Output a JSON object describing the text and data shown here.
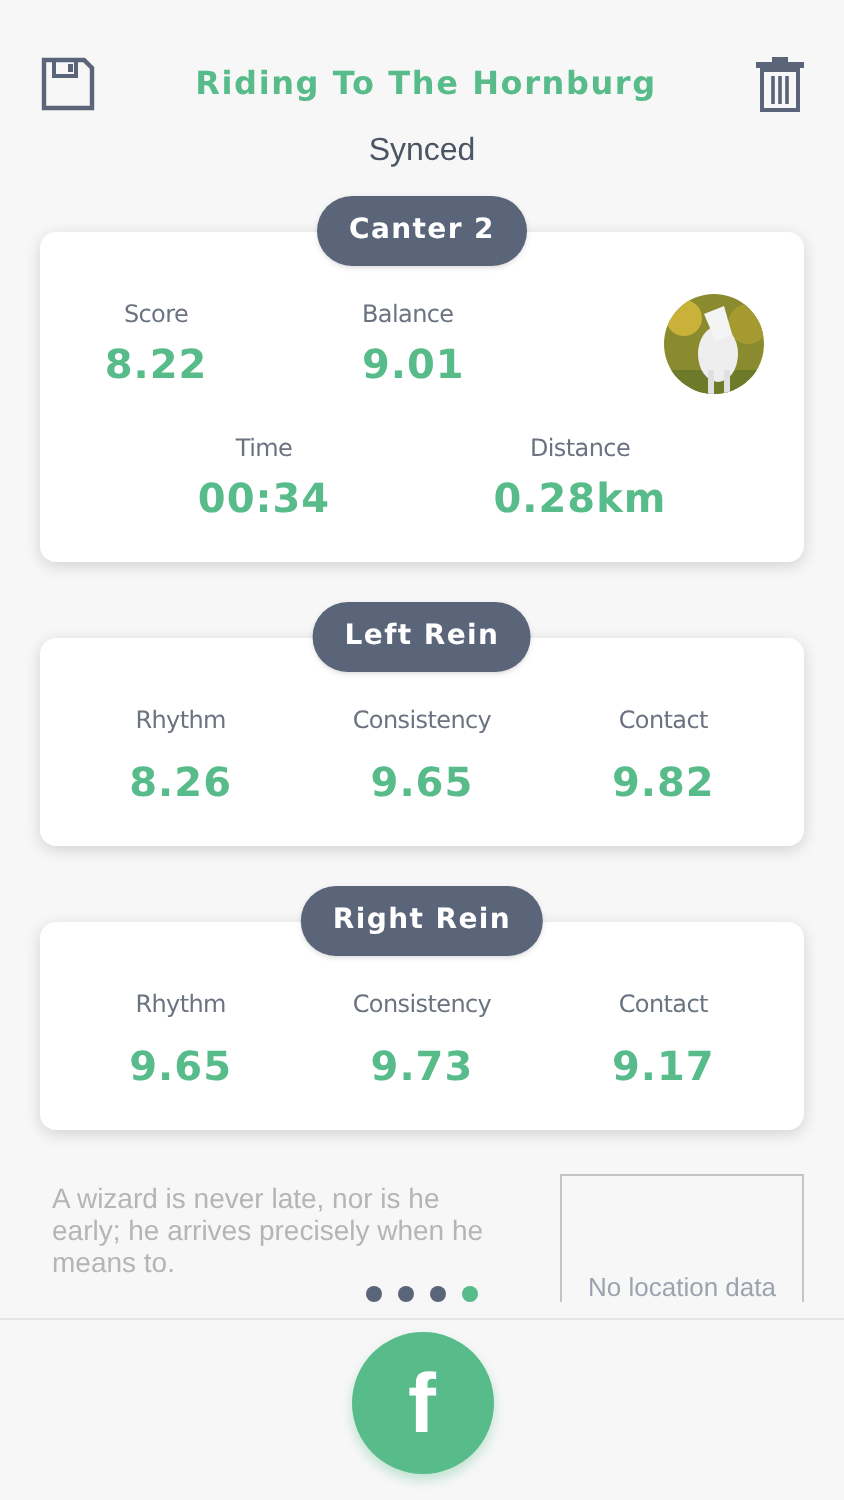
{
  "header": {
    "title": "Riding To The Hornburg",
    "status": "Synced"
  },
  "sections": [
    {
      "title": "Canter 2",
      "kind": "summary",
      "stats": [
        {
          "label": "Score",
          "value": "8.22"
        },
        {
          "label": "Balance",
          "value": "9.01"
        },
        {
          "label": "Time",
          "value": "00:34"
        },
        {
          "label": "Distance",
          "value": "0.28km"
        }
      ]
    },
    {
      "title": "Left Rein",
      "kind": "rein",
      "stats": [
        {
          "label": "Rhythm",
          "value": "8.26"
        },
        {
          "label": "Consistency",
          "value": "9.65"
        },
        {
          "label": "Contact",
          "value": "9.82"
        }
      ]
    },
    {
      "title": "Right Rein",
      "kind": "rein",
      "stats": [
        {
          "label": "Rhythm",
          "value": "9.65"
        },
        {
          "label": "Consistency",
          "value": "9.73"
        },
        {
          "label": "Contact",
          "value": "9.17"
        }
      ]
    }
  ],
  "note": {
    "quote": "A wizard is never late, nor is he early; he arrives precisely when he means to.",
    "map_placeholder": "No location data"
  },
  "pager": [
    {
      "selected": false
    },
    {
      "selected": false
    },
    {
      "selected": false
    },
    {
      "selected": true
    }
  ],
  "share_button": {
    "label": "f"
  }
}
